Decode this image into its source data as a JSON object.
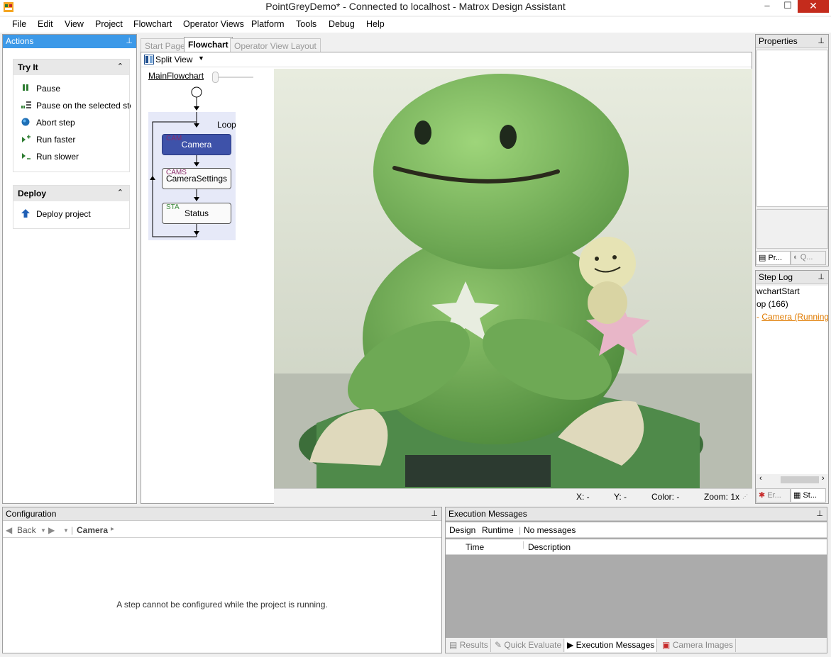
{
  "window": {
    "title": "PointGreyDemo* - Connected to localhost - Matrox Design Assistant",
    "minimize": "–",
    "maximize": "☐",
    "close": "✕"
  },
  "menu": [
    "File",
    "Edit",
    "View",
    "Project",
    "Flowchart",
    "Operator Views",
    "Platform",
    "Tools",
    "Debug",
    "Help"
  ],
  "actions_panel": {
    "title": "Actions",
    "pin": "📌",
    "try_it": {
      "title": "Try It",
      "items": [
        "Pause",
        "Pause on the selected step",
        "Abort step",
        "Run faster",
        "Run slower"
      ]
    },
    "deploy": {
      "title": "Deploy",
      "items": [
        "Deploy project"
      ]
    }
  },
  "doc_tabs": [
    "Start Page",
    "Flowchart",
    "Operator View Layout"
  ],
  "flowchart": {
    "split_view": "Split View",
    "main_link": "MainFlowchart",
    "loop_label": "Loop",
    "steps": [
      {
        "tag": "CAM",
        "label": "Camera"
      },
      {
        "tag": "CAMS",
        "label": "CameraSettings"
      },
      {
        "tag": "STA",
        "label": "Status"
      }
    ]
  },
  "image_status": {
    "x": "X: -",
    "y": "Y: -",
    "color": "Color: -",
    "zoom": "Zoom: 1x"
  },
  "properties_panel": {
    "title": "Properties",
    "tabs": [
      "Pr...",
      "Q..."
    ]
  },
  "step_log": {
    "title": "Step Log",
    "lines": [
      "wchartStart",
      "op (166)",
      "Camera (Running)"
    ],
    "tabs": [
      "Er...",
      "St..."
    ]
  },
  "configuration": {
    "title": "Configuration",
    "back": "Back",
    "breadcrumb": "Camera",
    "message": "A step cannot be configured while the project is running."
  },
  "execution_messages": {
    "title": "Execution Messages",
    "tabs": [
      "Design",
      "Runtime",
      "No messages"
    ],
    "columns": [
      "Time",
      "Description"
    ],
    "bottom_tabs": [
      "Results",
      "Quick Evaluate",
      "Execution Messages",
      "Camera Images"
    ]
  },
  "colors": {
    "accent_blue": "#3c99e8",
    "selected_step": "#3e52a9",
    "loop_bg": "#e6e9f8",
    "close_red": "#c42b1c",
    "log_link": "#e07b00"
  }
}
